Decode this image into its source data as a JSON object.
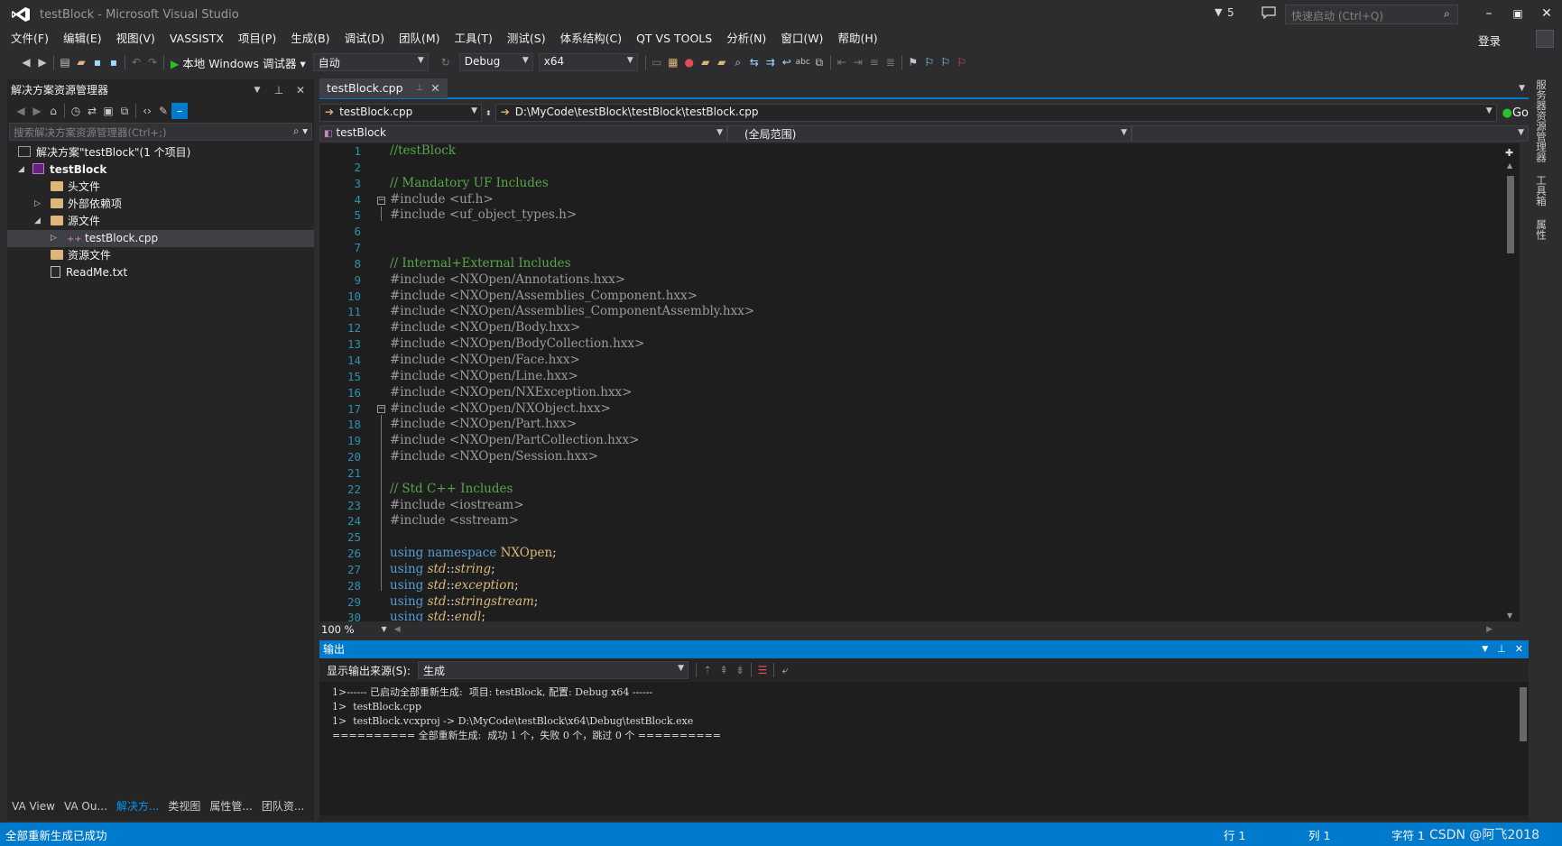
{
  "window": {
    "title": "testBlock - Microsoft Visual Studio",
    "filter_count": "5",
    "quick_launch_placeholder": "快速启动 (Ctrl+Q)",
    "login": "登录"
  },
  "menu": [
    "文件(F)",
    "编辑(E)",
    "视图(V)",
    "VASSISTX",
    "项目(P)",
    "生成(B)",
    "调试(D)",
    "团队(M)",
    "工具(T)",
    "测试(S)",
    "体系结构(C)",
    "QT VS TOOLS",
    "分析(N)",
    "窗口(W)",
    "帮助(H)"
  ],
  "toolbar": {
    "run_label": "本地 Windows 调试器",
    "mode": "自动",
    "configuration": "Debug",
    "platform": "x64"
  },
  "solution_explorer": {
    "title": "解决方案资源管理器",
    "search_placeholder": "搜索解决方案资源管理器(Ctrl+;)",
    "items": [
      {
        "label": "解决方案\"testBlock\"(1 个项目)"
      },
      {
        "label": "testBlock"
      },
      {
        "label": "头文件"
      },
      {
        "label": "外部依赖项"
      },
      {
        "label": "源文件"
      },
      {
        "label": "testBlock.cpp"
      },
      {
        "label": "资源文件"
      },
      {
        "label": "ReadMe.txt"
      }
    ],
    "selected_item": "testBlock.cpp"
  },
  "bottom_tabs": [
    "VA View",
    "VA Ou...",
    "解决方...",
    "类视图",
    "属性管...",
    "团队资..."
  ],
  "active_bottom_tab": "解决方...",
  "editor": {
    "tab_label": "testBlock.cpp",
    "nav_file": "testBlock.cpp",
    "nav_path": "D:\\MyCode\\testBlock\\testBlock\\testBlock.cpp",
    "go_label": "Go",
    "scope_left": "testBlock",
    "scope_middle": "(全局范围)",
    "zoom": "100 %",
    "line_numbers": [
      "1",
      "2",
      "3",
      "4",
      "5",
      "6",
      "7",
      "8",
      "9",
      "10",
      "11",
      "12",
      "13",
      "14",
      "15",
      "16",
      "17",
      "18",
      "19",
      "20",
      "21",
      "22",
      "23",
      "24",
      "25",
      "26",
      "27",
      "28",
      "29",
      "30"
    ],
    "lines": [
      "//testBlock",
      "",
      "// Mandatory UF Includes",
      "#include <uf.h>",
      "#include <uf_object_types.h>",
      "",
      "",
      "// Internal+External Includes",
      "#include <NXOpen/Annotations.hxx>",
      "#include <NXOpen/Assemblies_Component.hxx>",
      "#include <NXOpen/Assemblies_ComponentAssembly.hxx>",
      "#include <NXOpen/Body.hxx>",
      "#include <NXOpen/BodyCollection.hxx>",
      "#include <NXOpen/Face.hxx>",
      "#include <NXOpen/Line.hxx>",
      "#include <NXOpen/NXException.hxx>",
      "#include <NXOpen/NXObject.hxx>",
      "#include <NXOpen/Part.hxx>",
      "#include <NXOpen/PartCollection.hxx>",
      "#include <NXOpen/Session.hxx>",
      "",
      "// Std C++ Includes",
      "#include <iostream>",
      "#include <sstream>",
      "",
      "using namespace NXOpen;",
      "using std::string;",
      "using std::exception;",
      "using std::stringstream;",
      "using std::endl;"
    ]
  },
  "output": {
    "title": "输出",
    "source_label": "显示输出来源(S):",
    "source_value": "生成",
    "lines": [
      "1>------ 已启动全部重新生成:  项目: testBlock, 配置: Debug x64 ------",
      "1>  testBlock.cpp",
      "1>  testBlock.vcxproj -> D:\\MyCode\\testBlock\\x64\\Debug\\testBlock.exe",
      "========== 全部重新生成:  成功 1 个，失败 0 个，跳过 0 个 =========="
    ]
  },
  "right_rail": [
    "服务器资源管理器",
    "工具箱",
    "属性"
  ],
  "status": {
    "message": "全部重新生成已成功",
    "row": "行 1",
    "col": "列 1",
    "char": "字符 1",
    "watermark": "CSDN @阿飞2018"
  },
  "colors": {
    "accent": "#007acc",
    "background": "#2d2d30",
    "editor_bg": "#1e1e1e",
    "comment": "#57a64a",
    "keyword": "#569cd6",
    "line_number": "#2b91af"
  }
}
